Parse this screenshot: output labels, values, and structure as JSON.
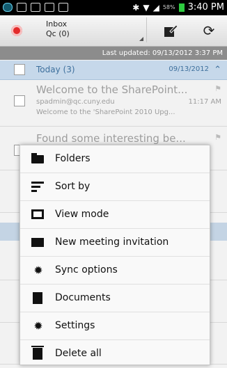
{
  "status_bar": {
    "battery": "58%",
    "time": "3:40 PM"
  },
  "toolbar": {
    "folder_name": "Inbox",
    "folder_account": "Qc (0)"
  },
  "last_updated": "Last updated: 09/13/2012 3:37 PM",
  "group": {
    "label": "Today (3)",
    "date": "09/13/2012"
  },
  "emails": [
    {
      "subject": "Welcome to the SharePoint...",
      "from": "spadmin@qc.cuny.edu",
      "time": "11:17 AM",
      "preview": "Welcome to the 'SharePoint 2010 Upg..."
    },
    {
      "subject": "Found some interesting be..."
    }
  ],
  "menu": {
    "items": [
      {
        "label": "Folders",
        "icon": "folder-icon"
      },
      {
        "label": "Sort by",
        "icon": "sort-icon"
      },
      {
        "label": "View mode",
        "icon": "view-mode-icon"
      },
      {
        "label": "New meeting invitation",
        "icon": "envelope-icon"
      },
      {
        "label": "Sync options",
        "icon": "gear-icon"
      },
      {
        "label": "Documents",
        "icon": "document-icon"
      },
      {
        "label": "Settings",
        "icon": "gear-icon"
      },
      {
        "label": "Delete all",
        "icon": "trash-icon"
      }
    ]
  },
  "colors": {
    "group_header_bg": "#c6d8ea",
    "accent": "#3d6f9c",
    "status_bar": "#000000",
    "updated_bar": "#8c8c8c"
  }
}
